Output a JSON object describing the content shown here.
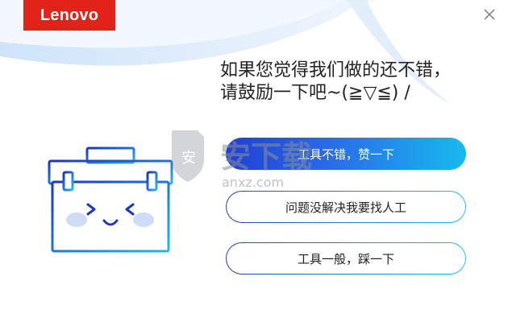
{
  "window": {
    "logo_text": "Lenovo",
    "close_label": "×"
  },
  "feedback": {
    "line1": "如果您觉得我们做的还不错，",
    "line2": "请鼓励一下吧~(≧▽≦) /"
  },
  "buttons": {
    "good": "工具不错，赞一下",
    "unsolved": "问题没解决我要找人工",
    "average": "工具一般，踩一下"
  },
  "watermark": {
    "text": "安下载",
    "url": "anxz.com"
  },
  "colors": {
    "brand_red": "#e2231a",
    "primary_start": "#1f3fd4",
    "primary_end": "#18b9ee"
  },
  "icons": {
    "toolbox": "toolbox-face-icon",
    "close": "close-icon"
  }
}
